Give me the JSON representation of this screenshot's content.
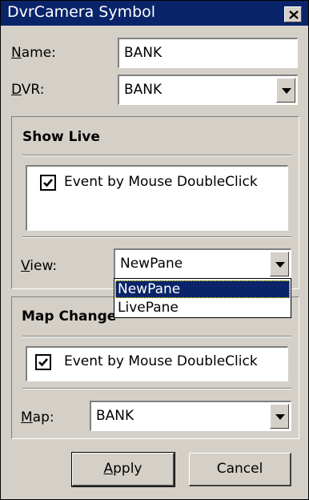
{
  "window": {
    "title": "DvrCamera Symbol"
  },
  "name_field": {
    "label_key": "N",
    "label_rest": "ame:",
    "value": "BANK"
  },
  "dvr_field": {
    "label_key": "D",
    "label_rest": "VR:",
    "value": "BANK"
  },
  "show_live": {
    "title": "Show Live",
    "checkbox_label": "Event by Mouse DoubleClick",
    "checked": true,
    "view_label_key": "V",
    "view_label_rest": "iew:",
    "view_value": "NewPane",
    "view_options": [
      "NewPane",
      "LivePane"
    ],
    "selected_option": "NewPane"
  },
  "map_change": {
    "title": "Map Change",
    "checkbox_label": "Event by Mouse DoubleClick",
    "checked": true,
    "map_label_key": "M",
    "map_label_rest": "ap:",
    "map_value": "BANK"
  },
  "buttons": {
    "apply_key": "A",
    "apply_rest": "pply",
    "cancel": "Cancel"
  },
  "icons": {
    "close": "close-icon",
    "dropdown": "chevron-down-icon",
    "check": "checkmark-icon"
  },
  "colors": {
    "titlebar": "#0a246a",
    "dialog_bg": "#d4d0c8",
    "selection": "#0a246a"
  }
}
